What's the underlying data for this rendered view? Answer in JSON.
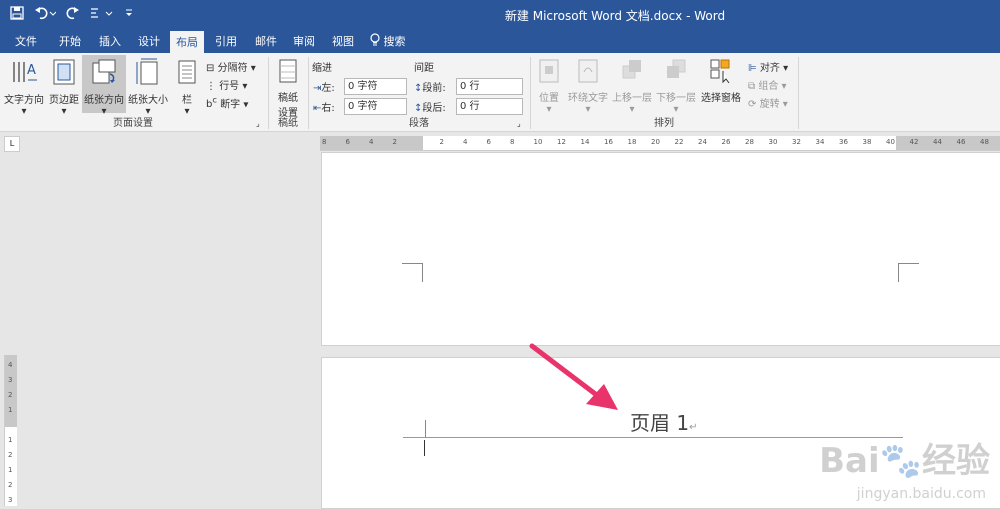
{
  "window": {
    "title": "新建 Microsoft Word 文档.docx  -  Word"
  },
  "tabs": [
    {
      "label": "文件"
    },
    {
      "label": "开始"
    },
    {
      "label": "插入"
    },
    {
      "label": "设计"
    },
    {
      "label": "布局",
      "active": true
    },
    {
      "label": "引用"
    },
    {
      "label": "邮件"
    },
    {
      "label": "审阅"
    },
    {
      "label": "视图"
    },
    {
      "label": "搜索"
    }
  ],
  "page_setup": {
    "text_direction": "文字方向",
    "margins": "页边距",
    "orientation": "纸张方向",
    "size": "纸张大小",
    "columns": "栏",
    "breaks": "分隔符",
    "line_numbers": "行号",
    "hyphenation": "断字",
    "group_label": "页面设置"
  },
  "manuscript": {
    "label_line1": "稿纸",
    "label_line2": "设置",
    "group_label": "稿纸"
  },
  "paragraph": {
    "indent_title": "缩进",
    "spacing_title": "间距",
    "left_label": "左:",
    "left_value": "0 字符",
    "right_label": "右:",
    "right_value": "0 字符",
    "before_label": "段前:",
    "before_value": "0 行",
    "after_label": "段后:",
    "after_value": "0 行",
    "group_label": "段落"
  },
  "arrange": {
    "position": "位置",
    "wrap_text": "环绕文字",
    "bring_forward": "上移一层",
    "send_backward": "下移一层",
    "selection_pane": "选择窗格",
    "align": "对齐",
    "group": "组合",
    "rotate": "旋转",
    "group_label": "排列"
  },
  "ruler": {
    "corner": "L",
    "ticks": [
      "8",
      "6",
      "4",
      "2",
      "",
      "2",
      "4",
      "6",
      "8",
      "10",
      "12",
      "14",
      "16",
      "18",
      "20",
      "22",
      "24",
      "26",
      "28",
      "30",
      "32",
      "34",
      "36",
      "38",
      "40",
      "42",
      "44",
      "46",
      "48"
    ],
    "vticks": [
      "4",
      "3",
      "2",
      "1",
      "",
      "1",
      "2",
      "1",
      "2",
      "3"
    ]
  },
  "document": {
    "header_text": "页眉 1"
  },
  "watermark": {
    "brand": "Bai",
    "brand2": "经验",
    "url": "jingyan.baidu.com"
  },
  "colors": {
    "accent": "#2b579a",
    "arrow": "#e8336b"
  }
}
